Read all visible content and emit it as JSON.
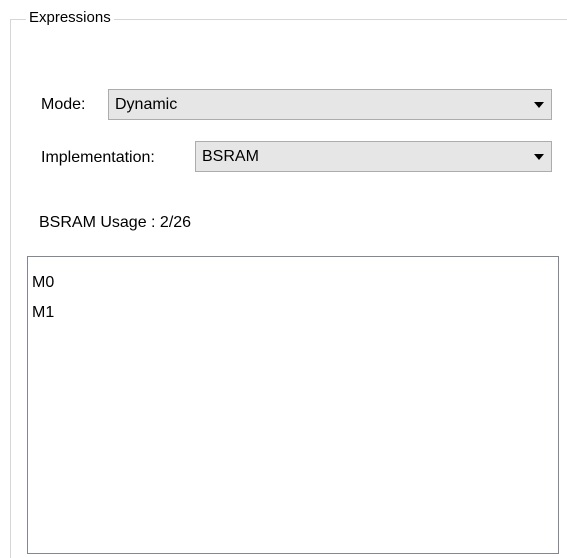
{
  "group": {
    "title": "Expressions"
  },
  "mode": {
    "label": "Mode:",
    "selected": "Dynamic"
  },
  "implementation": {
    "label": "Implementation:",
    "selected": "BSRAM"
  },
  "usage": {
    "text": "BSRAM Usage : 2/26"
  },
  "expressions_list": {
    "items": [
      "M0",
      "M1"
    ]
  },
  "icons": {
    "dropdown": "chevron-down-icon"
  }
}
